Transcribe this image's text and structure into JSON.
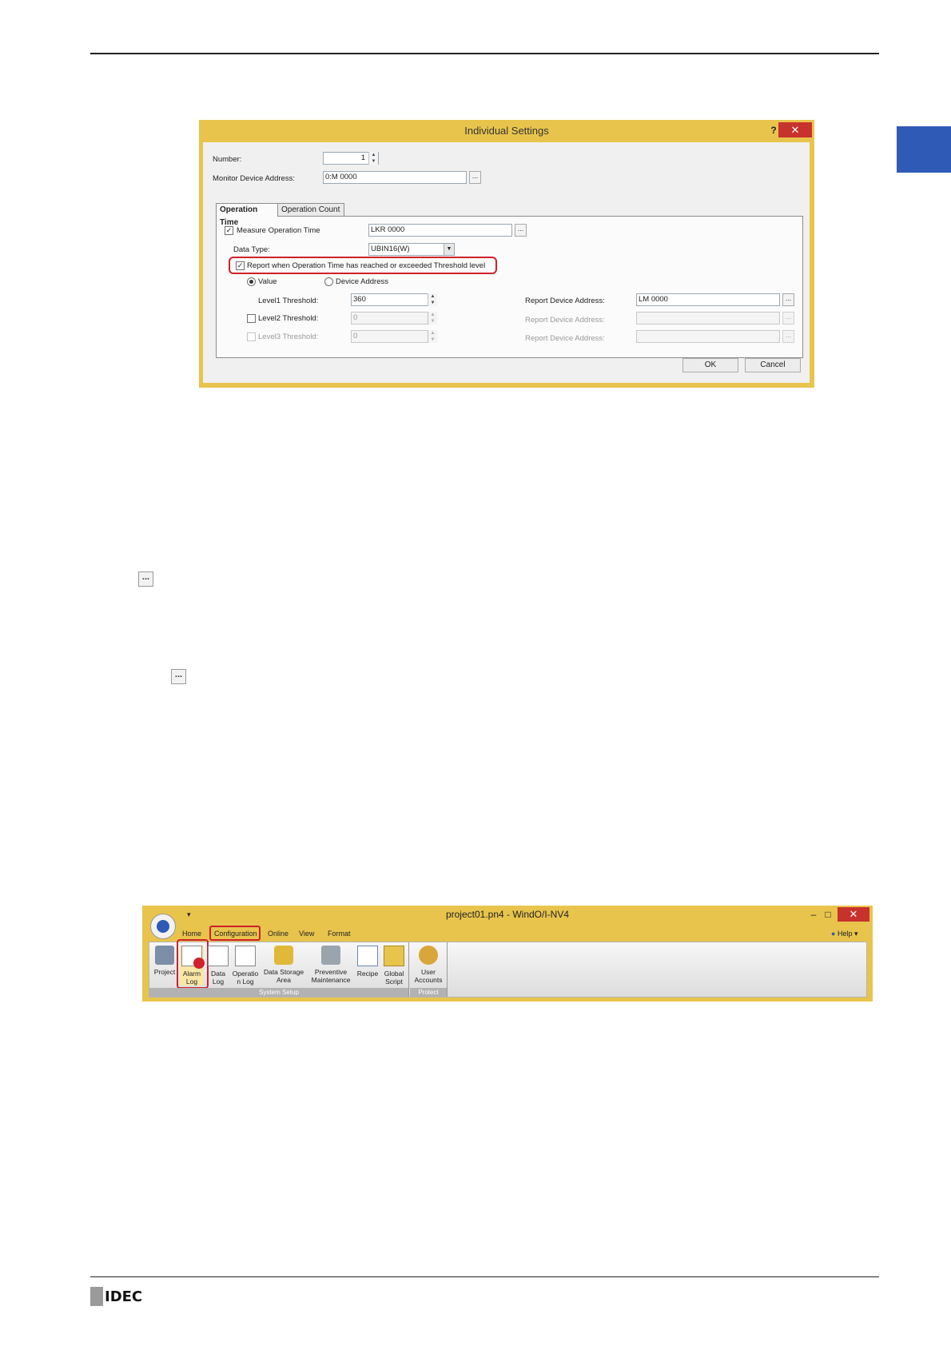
{
  "dialog": {
    "title": "Individual Settings",
    "help": "?",
    "close": "✕",
    "number_label": "Number:",
    "number_value": "1",
    "monitor_label": "Monitor Device Address:",
    "monitor_value": "0:M 0000",
    "dots": "...",
    "tabs": [
      "Operation Time",
      "Operation Count"
    ],
    "measure_label": "Measure Operation Time",
    "measure_value": "LKR 0000",
    "data_type_label": "Data Type:",
    "data_type_value": "UBIN16(W)",
    "report_label": "Report when Operation Time has reached or exceeded Threshold level",
    "radio_value": "Value",
    "radio_device": "Device Address",
    "level1_label": "Level1 Threshold:",
    "level1_value": "360",
    "level2_label": "Level2 Threshold:",
    "level2_value": "0",
    "level3_label": "Level3 Threshold:",
    "level3_value": "0",
    "report_addr_label": "Report Device Address:",
    "report_addr_value": "LM 0000",
    "ok": "OK",
    "cancel": "Cancel",
    "checkmark": "✓"
  },
  "ellipsis_icon": "...",
  "ribbon": {
    "title": "project01.pn4 - WindO/I-NV4",
    "qat": "▾",
    "menu": [
      "Home",
      "Configuration",
      "Online",
      "View",
      "Format"
    ],
    "help": "Help",
    "minimize": "–",
    "maximize": "□",
    "close": "✕",
    "items": [
      "Project",
      "Alarm Log",
      "Data Log",
      "Operation Log",
      "Data Storage Area",
      "Preventive Maintenance",
      "Recipe",
      "Global Script",
      "User Accounts"
    ],
    "item_lines": [
      [
        "Project"
      ],
      [
        "Alarm",
        "Log"
      ],
      [
        "Data",
        "Log"
      ],
      [
        "Operatio",
        "n Log"
      ],
      [
        "Data Storage",
        "Area"
      ],
      [
        "Preventive",
        "Maintenance"
      ],
      [
        "Recipe"
      ],
      [
        "Global",
        "Script"
      ],
      [
        "User",
        "Accounts"
      ]
    ],
    "groups": [
      "System Setup",
      "Protect"
    ]
  },
  "footer": {
    "logo": "IDEC"
  },
  "colors": {
    "accent_blue": "#2f5bb7",
    "title_bar": "#e8c44c",
    "highlight_red": "#d0202c"
  }
}
